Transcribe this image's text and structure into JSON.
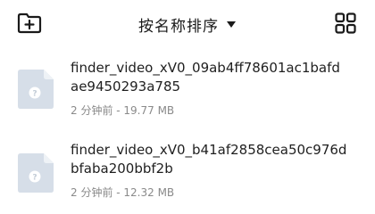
{
  "header": {
    "new_folder_icon": "new-folder-icon",
    "sort_label": "按名称排序",
    "sort_caret_icon": "caret-down-icon",
    "view_toggle_icon": "grid-view-icon"
  },
  "files": [
    {
      "name": "finder_video_xV0_09ab4ff78601ac1bafdae9450293a785",
      "meta": "2 分钟前 - 19.77 MB",
      "icon": "unknown-file-icon"
    },
    {
      "name": "finder_video_xV0_b41af2858cea50c976dbfaba200bbf2b",
      "meta": "2 分钟前 - 12.32 MB",
      "icon": "unknown-file-icon"
    }
  ],
  "colors": {
    "thumb": "#d6dee8",
    "thumb_fold": "#eef2f6",
    "meta_text": "#8a8a8a"
  }
}
